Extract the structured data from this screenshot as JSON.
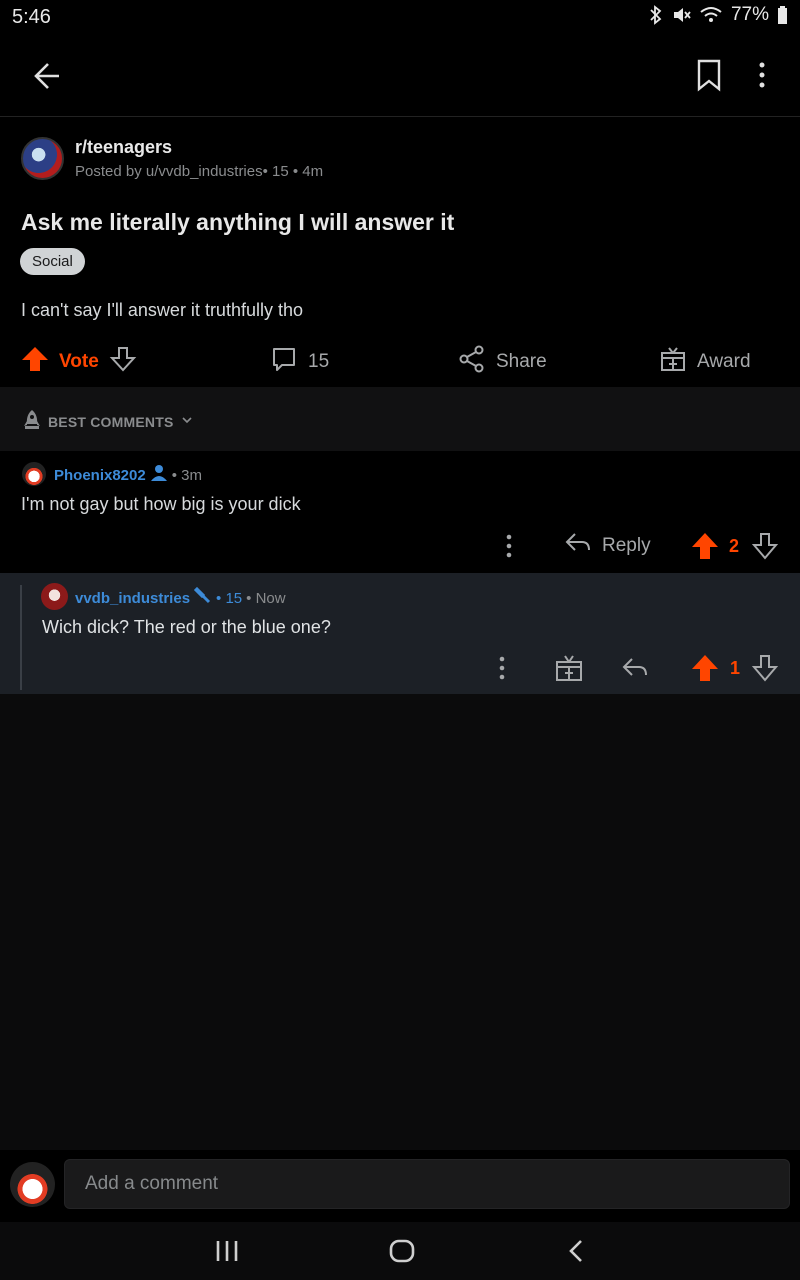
{
  "status_bar": {
    "time": "5:46",
    "battery": "77%"
  },
  "post": {
    "subreddit": "r/teenagers",
    "meta": "Posted by u/vvdb_industries• 15 • 4m",
    "title": "Ask me literally anything I will answer it",
    "flair": "Social",
    "body": "I can't say I'll answer it truthfully tho",
    "vote_label": "Vote",
    "comment_count": "15",
    "share_label": "Share",
    "award_label": "Award"
  },
  "sort": {
    "label": "BEST COMMENTS"
  },
  "comments": [
    {
      "user": "Phoenix8202",
      "time": "• 3m",
      "text": "I'm not gay but how big is your dick",
      "reply_label": "Reply",
      "score": "2"
    },
    {
      "user": "vvdb_industries",
      "flair_num": "• 15",
      "time": "• Now",
      "text": "Wich dick? The red or the blue one?",
      "score": "1"
    }
  ],
  "composer": {
    "placeholder": "Add a comment"
  },
  "colors": {
    "upvote": "#ff4500",
    "username": "#3d8bd8",
    "background": "#000000",
    "reply_bg": "#1c2026"
  }
}
